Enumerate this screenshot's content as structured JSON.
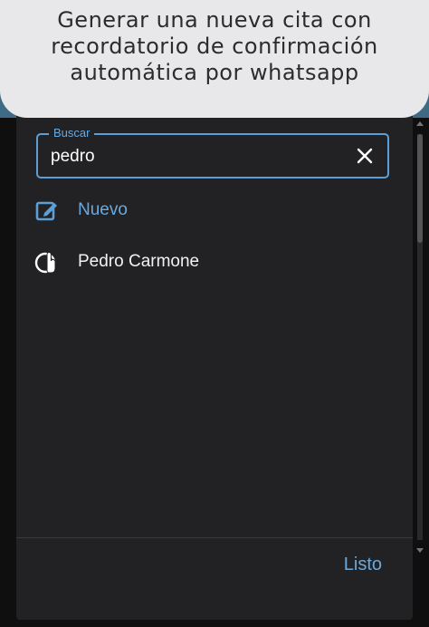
{
  "banner": {
    "caption": "Generar una nueva cita con recordatorio de confirmación automática por whatsapp"
  },
  "dialog": {
    "search": {
      "legend": "Buscar",
      "value": "pedro",
      "clear_icon": "close-icon"
    },
    "new_item": {
      "icon": "edit-icon",
      "label": "Nuevo"
    },
    "results": [
      {
        "icon": "pointer-hand-icon",
        "label": "Pedro Carmone"
      }
    ],
    "done_label": "Listo"
  },
  "colors": {
    "accent": "#5c9fd6",
    "dialog_bg": "#222224",
    "banner_bg": "#e8e8ea"
  }
}
